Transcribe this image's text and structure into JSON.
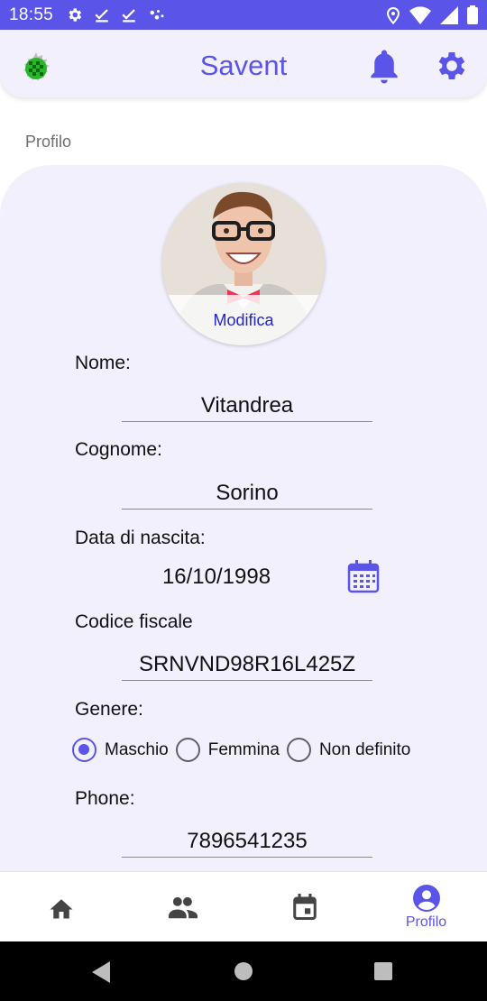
{
  "status_bar": {
    "time": "18:55"
  },
  "app_bar": {
    "title": "Savent"
  },
  "section": {
    "label": "Profilo"
  },
  "avatar": {
    "edit_label": "Modifica"
  },
  "form": {
    "nome_label": "Nome:",
    "nome_value": "Vitandrea",
    "cognome_label": "Cognome:",
    "cognome_value": "Sorino",
    "data_label": "Data di nascita:",
    "data_value": "16/10/1998",
    "cf_label": "Codice fiscale",
    "cf_value": "SRNVND98R16L425Z",
    "genere_label": "Genere:",
    "genere_options": [
      "Maschio",
      "Femmina",
      "Non definito"
    ],
    "genere_selected": "Maschio",
    "phone_label": "Phone:",
    "phone_value": "7896541235"
  },
  "bottom_nav": {
    "profile_label": "Profilo"
  },
  "icons": [
    "settings-icon",
    "check-icon",
    "location-icon",
    "wifi-icon",
    "signal-icon",
    "battery-icon",
    "bell-icon",
    "gear-icon",
    "calendar-icon",
    "home-icon",
    "people-icon",
    "event-icon",
    "account-circle-icon"
  ],
  "colors": {
    "primary": "#5b54e8",
    "surface": "#f1f0fc",
    "edit_link": "#2323d8"
  }
}
